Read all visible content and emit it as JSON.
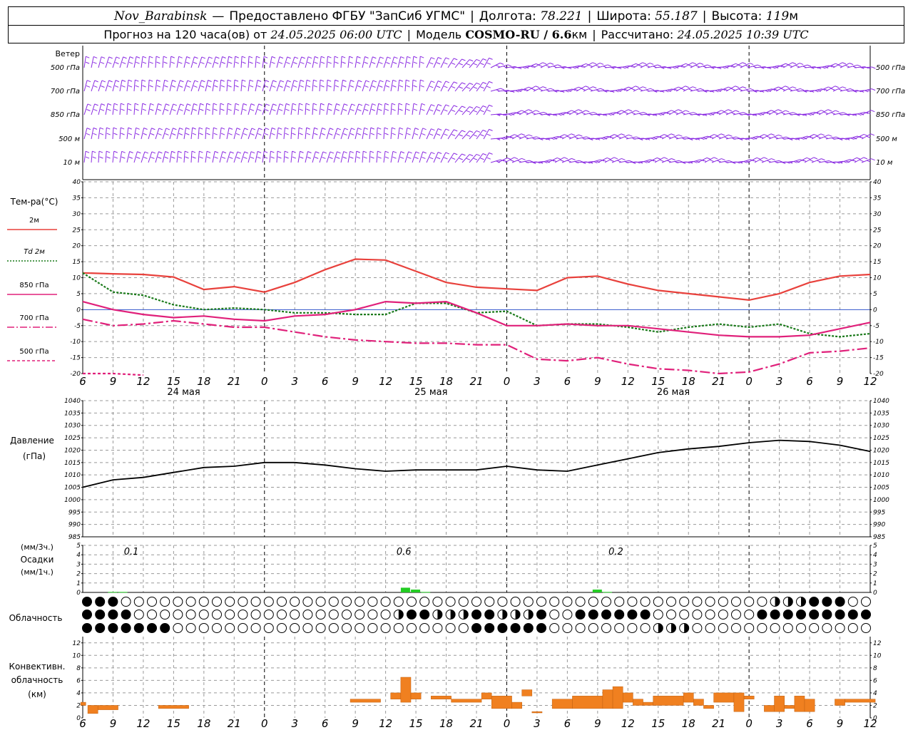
{
  "header": {
    "station": "Nov_Barabinsk",
    "dash": "—",
    "provider": "Предоставлено ФГБУ \"ЗапСиб УГМС\"",
    "lon_label": "Долгота:",
    "lon_value": "78.221",
    "lat_label": "Широта:",
    "lat_value": "55.187",
    "alt_label": "Высота:",
    "alt_value": "119",
    "alt_unit": "м",
    "forecast_label": "Прогноз на 120 часа(ов) от",
    "forecast_start": "24.05.2025 06:00 UTC",
    "model_label": "Модель",
    "model_name": "COSMO-RU / 6.6",
    "model_unit": "км",
    "calc_label": "Рассчитано:",
    "calc_time": "24.05.2025 10:39 UTC"
  },
  "hour_ticks": [
    "6",
    "9",
    "12",
    "15",
    "18",
    "21",
    "0",
    "3",
    "6",
    "9",
    "12",
    "15",
    "18",
    "21",
    "0",
    "3",
    "6",
    "9",
    "12",
    "15",
    "18",
    "21",
    "0",
    "3",
    "6",
    "9",
    "12"
  ],
  "day_labels": [
    "24 мая",
    "25 мая",
    "26 мая"
  ],
  "colors": {
    "wind": "#8a2be2",
    "t2m": "#e8413c",
    "td2m": "#1a7a1a",
    "t850": "#e0207a",
    "pressure": "#000000",
    "precip": "#22cc22",
    "convective": "#f08020",
    "grid": "#999999"
  },
  "panels": {
    "wind": {
      "title": "Ветер",
      "levels": [
        {
          "left": "500 гПа",
          "right": "500 гПа"
        },
        {
          "left": "700 гПа",
          "right": "700 гПа"
        },
        {
          "left": "850 гПа",
          "right": "850 гПа"
        },
        {
          "left": "500 м",
          "right": "500 м"
        },
        {
          "left": "10 м",
          "right": "10 м"
        }
      ]
    },
    "temperature": {
      "title": "Тем-ра(°C)",
      "legend": [
        {
          "label": "2м",
          "style": "solid"
        },
        {
          "label": "Td 2м",
          "style": "dotted"
        },
        {
          "label": "850 гПа",
          "style": "solid"
        },
        {
          "label": "700 гПа",
          "style": "dashdot"
        },
        {
          "label": "500 гПа",
          "style": "dashed"
        }
      ],
      "yticks": [
        "40",
        "35",
        "30",
        "25",
        "20",
        "15",
        "10",
        "5",
        "0",
        "-5",
        "-10",
        "-15",
        "-20"
      ]
    },
    "pressure": {
      "title1": "Давление",
      "title2": "(гПа)",
      "yticks": [
        "1040",
        "1035",
        "1030",
        "1025",
        "1020",
        "1015",
        "1010",
        "1005",
        "1000",
        "995",
        "990",
        "985"
      ]
    },
    "precip": {
      "unit1": "(мм/3ч.)",
      "title": "Осадки",
      "unit2": "(мм/1ч.)",
      "yticks": [
        "5",
        "4",
        "3",
        "2",
        "1",
        "0"
      ],
      "totals": [
        {
          "text": "0.1"
        },
        {
          "text": "0.6"
        },
        {
          "text": "0.2"
        }
      ]
    },
    "cloud": {
      "title": "Облачность"
    },
    "convective": {
      "title1": "Конвективн.",
      "title2": "облачность",
      "title3": "(км)",
      "yticks": [
        "12",
        "10",
        "8",
        "6",
        "4",
        "2",
        "0"
      ]
    }
  },
  "chart_data": [
    {
      "type": "line",
      "title": "Тем-ра(°C)",
      "ylim": [
        -20,
        40
      ],
      "x_hours": [
        0,
        3,
        6,
        9,
        12,
        15,
        18,
        21,
        24,
        27,
        30,
        33,
        36,
        39,
        42,
        45,
        48,
        51,
        54,
        57,
        60,
        63,
        66,
        69,
        72,
        75,
        78
      ],
      "series": [
        {
          "name": "2м",
          "values": [
            11.5,
            11.2,
            11.0,
            10.2,
            6.3,
            7.2,
            5.5,
            8.5,
            12.5,
            15.8,
            15.5,
            12.0,
            8.5,
            7.0,
            6.5,
            6.0,
            10.0,
            10.5,
            8.0,
            6.0,
            5.0,
            4.0,
            3.0,
            5.0,
            8.5,
            10.5,
            11.0
          ]
        },
        {
          "name": "Td 2м",
          "values": [
            11.5,
            5.5,
            4.5,
            1.5,
            0.0,
            0.5,
            0.0,
            -1.0,
            -1.0,
            -1.5,
            -1.5,
            2.0,
            2.0,
            -1.0,
            -0.5,
            -5.0,
            -4.5,
            -4.5,
            -5.5,
            -7.0,
            -5.5,
            -4.5,
            -5.5,
            -4.5,
            -7.5,
            -8.5,
            -7.5
          ]
        },
        {
          "name": "850 гПа",
          "values": [
            2.5,
            0.0,
            -1.5,
            -2.5,
            -2.0,
            -3.0,
            -3.5,
            -2.0,
            -1.5,
            0.0,
            2.5,
            2.0,
            2.5,
            -1.0,
            -5.0,
            -5.0,
            -4.5,
            -5.0,
            -5.0,
            -6.0,
            -7.0,
            -8.0,
            -8.5,
            -8.5,
            -8.0,
            -6.0,
            -4.0
          ]
        },
        {
          "name": "700 гПа",
          "values": [
            -3.0,
            -5.0,
            -4.5,
            -3.5,
            -4.5,
            -5.5,
            -5.5,
            -7.0,
            -8.5,
            -9.5,
            -10.0,
            -10.5,
            -10.5,
            -11.0,
            -11.0,
            -15.5,
            -16.0,
            -15.0,
            -17.0,
            -18.5,
            -19.0,
            -20.0,
            -19.5,
            -17.0,
            -13.5,
            -13.0,
            -12.0
          ]
        },
        {
          "name": "500 гПа",
          "values": [
            -20.0,
            -20.0,
            -20.5,
            null,
            null,
            null,
            null,
            null,
            null,
            null,
            null,
            null,
            null,
            null,
            null,
            null,
            null,
            null,
            null,
            null,
            null,
            null,
            null,
            null,
            null,
            null,
            null
          ]
        }
      ]
    },
    {
      "type": "line",
      "title": "Давление (гПа)",
      "ylim": [
        985,
        1040
      ],
      "x_hours": [
        0,
        3,
        6,
        9,
        12,
        15,
        18,
        21,
        24,
        27,
        30,
        33,
        36,
        39,
        42,
        45,
        48,
        51,
        54,
        57,
        60,
        63,
        66,
        69,
        72,
        75,
        78
      ],
      "series": [
        {
          "name": "Давление",
          "values": [
            1005.0,
            1008.0,
            1009.0,
            1011.0,
            1013.0,
            1013.5,
            1015.0,
            1015.0,
            1014.0,
            1012.5,
            1011.5,
            1012.0,
            1012.0,
            1012.0,
            1013.5,
            1012.0,
            1011.5,
            1014.0,
            1016.5,
            1019.0,
            1020.5,
            1021.5,
            1023.0,
            1024.0,
            1023.5,
            1022.0,
            1019.5
          ]
        }
      ]
    },
    {
      "type": "bar",
      "title": "Осадки (мм/1ч.)",
      "ylim": [
        0,
        5
      ],
      "x_hours": [
        3,
        4,
        32,
        33,
        34,
        51,
        52
      ],
      "values": [
        0.05,
        0.05,
        0.5,
        0.3,
        0.05,
        0.3,
        0.05
      ],
      "totals_3h": [
        {
          "hour": 4.5,
          "value": 0.1
        },
        {
          "hour": 31.5,
          "value": 0.6
        },
        {
          "hour": 52.5,
          "value": 0.2
        }
      ]
    },
    {
      "type": "bar",
      "title": "Конвективн. облачность (км)",
      "ylim": [
        0,
        13
      ],
      "bars": [
        {
          "h0": -0.2,
          "h1": 0.3,
          "bottom": 2.0,
          "top": 2.5
        },
        {
          "h0": 0.5,
          "h1": 1.5,
          "bottom": 0.7,
          "top": 2.0
        },
        {
          "h0": 1.5,
          "h1": 3.5,
          "bottom": 1.3,
          "top": 2.0
        },
        {
          "h0": 7.5,
          "h1": 10.5,
          "bottom": 1.5,
          "top": 2.0
        },
        {
          "h0": 26.5,
          "h1": 29.5,
          "bottom": 2.5,
          "top": 3.0
        },
        {
          "h0": 30.5,
          "h1": 31.5,
          "bottom": 3.0,
          "top": 4.0
        },
        {
          "h0": 31.5,
          "h1": 32.5,
          "bottom": 2.5,
          "top": 6.5
        },
        {
          "h0": 32.5,
          "h1": 33.5,
          "bottom": 3.0,
          "top": 4.0
        },
        {
          "h0": 34.5,
          "h1": 36.5,
          "bottom": 3.0,
          "top": 3.5
        },
        {
          "h0": 36.5,
          "h1": 39.5,
          "bottom": 2.5,
          "top": 3.0
        },
        {
          "h0": 39.5,
          "h1": 40.5,
          "bottom": 3.0,
          "top": 4.0
        },
        {
          "h0": 40.5,
          "h1": 42.5,
          "bottom": 1.5,
          "top": 3.5
        },
        {
          "h0": 42.5,
          "h1": 43.5,
          "bottom": 1.5,
          "top": 2.5
        },
        {
          "h0": 43.5,
          "h1": 44.5,
          "bottom": 3.5,
          "top": 4.5
        },
        {
          "h0": 44.5,
          "h1": 45.5,
          "bottom": 0.8,
          "top": 1.0
        },
        {
          "h0": 46.5,
          "h1": 48.5,
          "bottom": 1.5,
          "top": 3.0
        },
        {
          "h0": 48.5,
          "h1": 51.5,
          "bottom": 1.5,
          "top": 3.5
        },
        {
          "h0": 51.5,
          "h1": 52.5,
          "bottom": 1.5,
          "top": 4.5
        },
        {
          "h0": 52.5,
          "h1": 53.5,
          "bottom": 1.5,
          "top": 5.0
        },
        {
          "h0": 53.5,
          "h1": 54.5,
          "bottom": 2.5,
          "top": 4.0
        },
        {
          "h0": 54.5,
          "h1": 55.5,
          "bottom": 2.0,
          "top": 3.0
        },
        {
          "h0": 55.5,
          "h1": 56.5,
          "bottom": 2.0,
          "top": 2.5
        },
        {
          "h0": 56.5,
          "h1": 59.5,
          "bottom": 2.0,
          "top": 3.5
        },
        {
          "h0": 59.5,
          "h1": 60.5,
          "bottom": 2.5,
          "top": 4.0
        },
        {
          "h0": 60.5,
          "h1": 61.5,
          "bottom": 2.0,
          "top": 3.0
        },
        {
          "h0": 61.5,
          "h1": 62.5,
          "bottom": 1.5,
          "top": 2.0
        },
        {
          "h0": 62.5,
          "h1": 64.5,
          "bottom": 2.5,
          "top": 4.0
        },
        {
          "h0": 64.5,
          "h1": 65.5,
          "bottom": 1.0,
          "top": 4.0
        },
        {
          "h0": 65.5,
          "h1": 66.5,
          "bottom": 3.0,
          "top": 3.5
        },
        {
          "h0": 67.5,
          "h1": 68.5,
          "bottom": 1.0,
          "top": 2.0
        },
        {
          "h0": 68.5,
          "h1": 69.5,
          "bottom": 1.0,
          "top": 3.5
        },
        {
          "h0": 69.5,
          "h1": 70.5,
          "bottom": 1.5,
          "top": 2.0
        },
        {
          "h0": 70.5,
          "h1": 71.5,
          "bottom": 1.0,
          "top": 3.5
        },
        {
          "h0": 71.5,
          "h1": 72.5,
          "bottom": 1.0,
          "top": 3.0
        },
        {
          "h0": 74.5,
          "h1": 75.5,
          "bottom": 2.0,
          "top": 3.0
        },
        {
          "h0": 75.5,
          "h1": 78.5,
          "bottom": 2.5,
          "top": 3.0
        }
      ]
    }
  ]
}
